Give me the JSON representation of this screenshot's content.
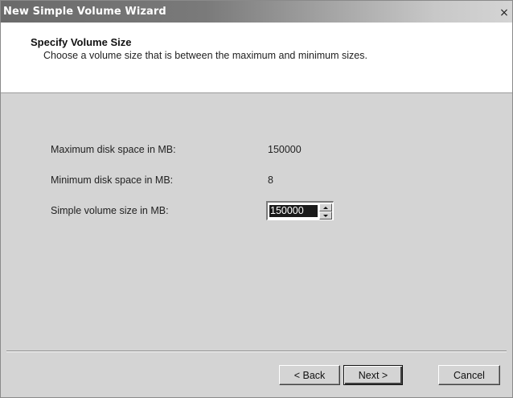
{
  "window": {
    "title": "New Simple Volume Wizard",
    "close_glyph": "×"
  },
  "header": {
    "title": "Specify Volume Size",
    "subtitle": "Choose a volume size that is between the maximum and minimum sizes."
  },
  "fields": {
    "max_label": "Maximum disk space in MB:",
    "max_value": "150000",
    "min_label": "Minimum disk space in MB:",
    "min_value": "8",
    "size_label": "Simple volume size in MB:",
    "size_value": "150000"
  },
  "buttons": {
    "back": "< Back",
    "next": "Next >",
    "cancel": "Cancel"
  },
  "icons": {
    "close": "close-icon",
    "spin_up": "chevron-up-icon",
    "spin_down": "chevron-down-icon"
  }
}
